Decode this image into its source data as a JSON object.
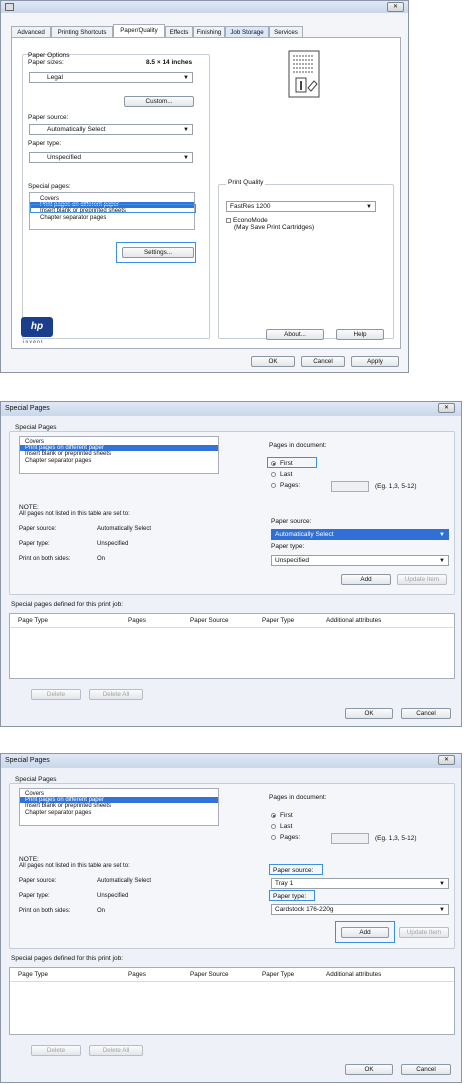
{
  "top": {
    "title_text": "",
    "close_label": "✕",
    "tabs": [
      "Advanced",
      "Printing Shortcuts",
      "Paper/Quality",
      "Effects",
      "Finishing",
      "Job Storage",
      "Services"
    ],
    "paper_options_title": "Paper Options",
    "paper_sizes_label": "Paper sizes:",
    "paper_size_dim": "8.5 × 14 inches",
    "paper_size_value": "Legal",
    "custom_button": "Custom...",
    "paper_source_label": "Paper source:",
    "paper_source_value": "Automatically Select",
    "paper_type_label": "Paper type:",
    "paper_type_value": "Unspecified",
    "special_pages_label": "Special pages:",
    "special_pages_items": [
      "Covers",
      "Print pages on different paper",
      "Insert blank or preprinted sheets",
      "Chapter separator pages"
    ],
    "settings_button": "Settings...",
    "print_quality_title": "Print Quality",
    "print_quality_value": "FastRes 1200",
    "economode_label": "EconoMode",
    "economode_sub": "(May Save Print Cartridges)",
    "logo_text": "hp",
    "logo_sub": "invent",
    "about_button": "About...",
    "help_button": "Help",
    "ok_button": "OK",
    "cancel_button": "Cancel",
    "apply_button": "Apply"
  },
  "dialog1": {
    "title": "Special Pages",
    "close_label": "✕",
    "group_title": "Special Pages",
    "list_items": [
      "Covers",
      "Print pages on different paper",
      "Insert blank or preprinted sheets",
      "Chapter separator pages"
    ],
    "pages_in_doc_label": "Pages in document:",
    "radio_first": "First",
    "radio_last": "Last",
    "radio_pages": "Pages:",
    "pages_example": "(Eg. 1,3, 5-12)",
    "note_title": "NOTE:",
    "note_text": "All pages not listed in this table are set to:",
    "paper_source_label": "Paper source:",
    "paper_source_value": "Automatically Select",
    "paper_type_label": "Paper type:",
    "paper_type_value": "Unspecified",
    "print_both_label": "Print on both sides:",
    "print_both_value": "On",
    "right_paper_source_label": "Paper source:",
    "right_paper_source_value": "Automatically Select",
    "right_paper_type_label": "Paper type:",
    "right_paper_type_value": "Unspecified",
    "add_button": "Add",
    "update_button": "Update Item",
    "defined_label": "Special pages defined for this print job:",
    "columns": [
      "Page Type",
      "Pages",
      "Paper Source",
      "Paper Type",
      "Additional attributes"
    ],
    "delete_button": "Delete",
    "delete_all_button": "Delete All",
    "ok_button": "OK",
    "cancel_button": "Cancel"
  },
  "dialog2": {
    "title": "Special Pages",
    "close_label": "✕",
    "group_title": "Special Pages",
    "list_items": [
      "Covers",
      "Print pages on different paper",
      "Insert blank or preprinted sheets",
      "Chapter separator pages"
    ],
    "pages_in_doc_label": "Pages in document:",
    "radio_first": "First",
    "radio_last": "Last",
    "radio_pages": "Pages:",
    "pages_example": "(Eg. 1,3, 5-12)",
    "note_title": "NOTE:",
    "note_text": "All pages not listed in this table are set to:",
    "paper_source_label": "Paper source:",
    "paper_source_value": "Automatically Select",
    "paper_type_label": "Paper type:",
    "paper_type_value": "Unspecified",
    "print_both_label": "Print on both sides:",
    "print_both_value": "On",
    "right_paper_source_label": "Paper source:",
    "right_paper_source_value": "Tray 1",
    "right_paper_type_label": "Paper type:",
    "right_paper_type_value": "Cardstock 176-220g",
    "add_button": "Add",
    "update_button": "Update Item",
    "defined_label": "Special pages defined for this print job:",
    "columns": [
      "Page Type",
      "Pages",
      "Paper Source",
      "Paper Type",
      "Additional attributes"
    ],
    "delete_button": "Delete",
    "delete_all_button": "Delete All",
    "ok_button": "OK",
    "cancel_button": "Cancel"
  },
  "colors": {
    "accent": "#3173d8",
    "highlight_outline": "#3b90e5"
  }
}
